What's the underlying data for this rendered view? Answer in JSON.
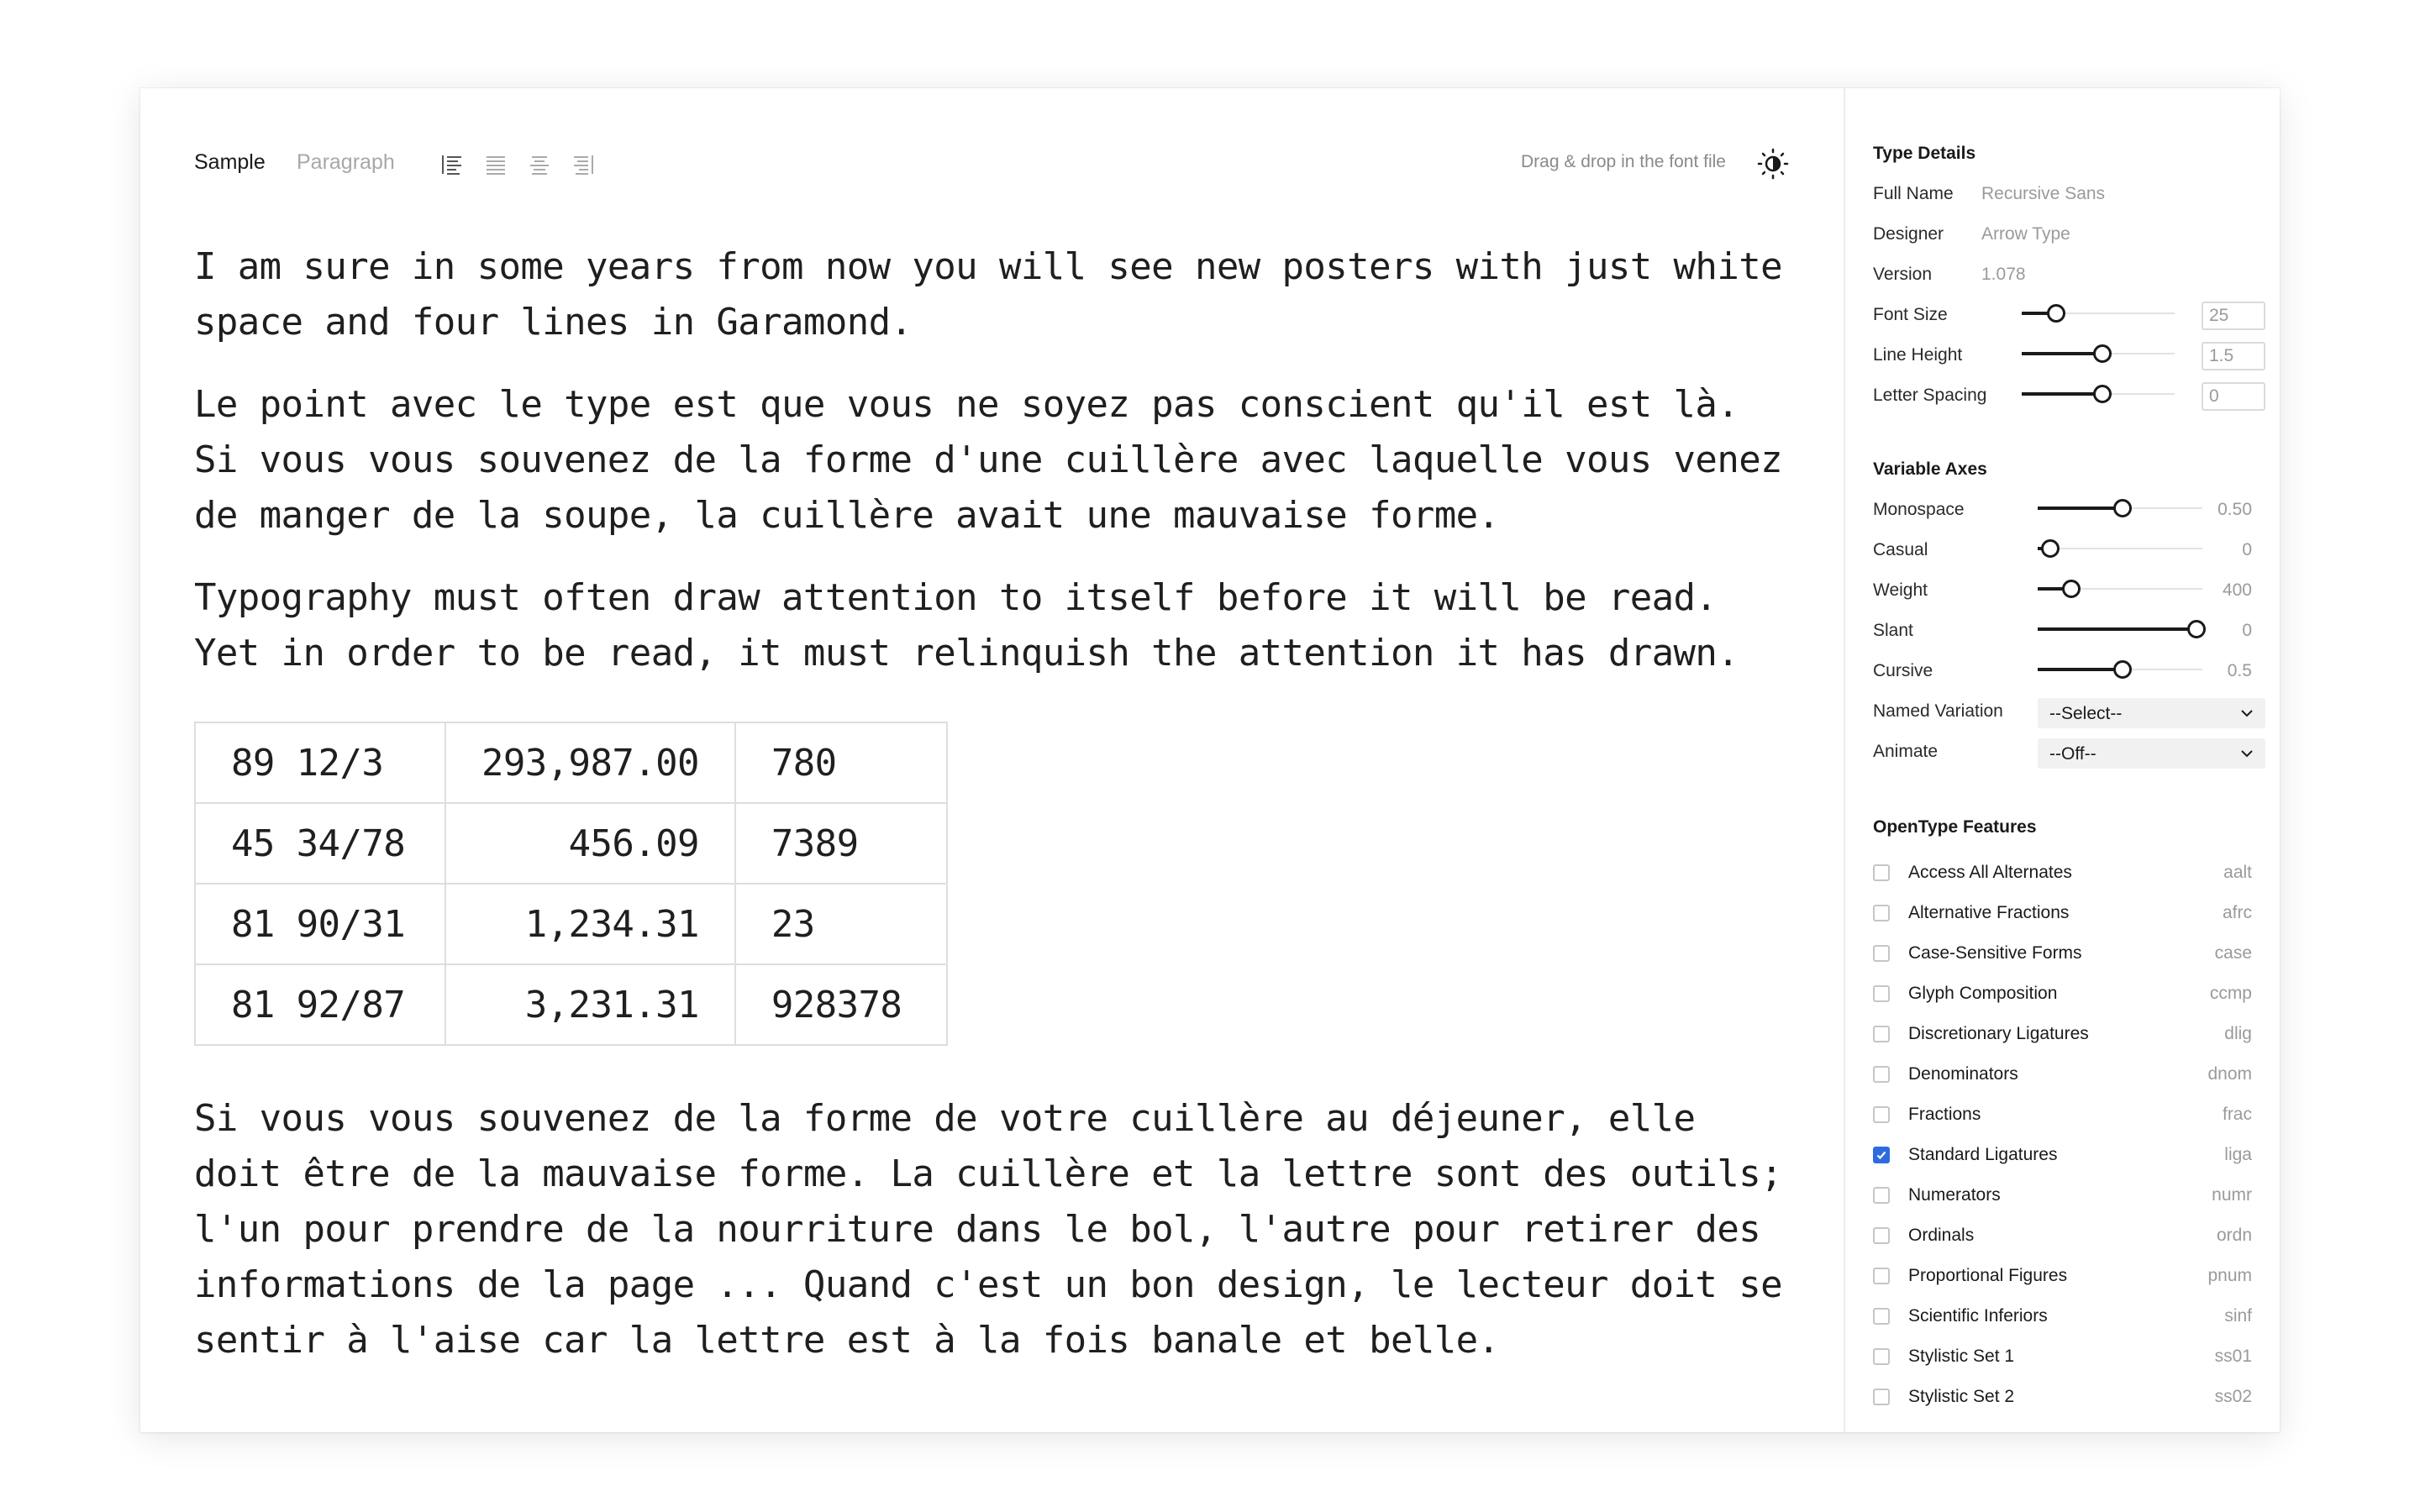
{
  "toolbar": {
    "tabs": [
      {
        "label": "Sample",
        "active": true
      },
      {
        "label": "Paragraph",
        "active": false
      }
    ],
    "align_icons": [
      "align-left-icon",
      "align-justify-icon",
      "align-center-icon",
      "align-right-icon"
    ],
    "drop_hint": "Drag & drop in the font file",
    "theme_icon": "brightness-toggle-icon"
  },
  "sample": {
    "paragraphs": [
      "I am sure in some years from now you will see new posters with just white space and four lines in Garamond.",
      "Le point avec le type est que vous ne soyez pas conscient qu'il est là. Si vous vous souvenez de la forme d'une cuillère avec laquelle vous venez de manger de la soupe, la cuillère avait une mauvaise forme.",
      "Typography must often draw attention to itself before it will be read. Yet in order to be read, it must relinquish the attention it has drawn.",
      "Si vous vous souvenez de la forme de votre cuillère au déjeuner, elle doit être de la mauvaise forme. La cuillère et la lettre sont des outils; l'un pour prendre de la nourriture dans le bol, l'autre pour retirer des informations de la page ... Quand c'est un bon design, le lecteur doit se sentir à l'aise car la lettre est à la fois banale et belle."
    ],
    "table": [
      [
        "89 12/3",
        "293,987.00",
        "780"
      ],
      [
        "45 34/78",
        "456.09",
        "7389"
      ],
      [
        "81 90/31",
        "1,234.31",
        "23"
      ],
      [
        "81 92/87",
        "3,231.31",
        "928378"
      ]
    ]
  },
  "sidebar": {
    "type_details": {
      "title": "Type Details",
      "full_name_label": "Full Name",
      "full_name": "Recursive Sans",
      "designer_label": "Designer",
      "designer": "Arrow Type",
      "version_label": "Version",
      "version": "1.078",
      "font_size_label": "Font Size",
      "font_size": "25",
      "font_size_level": 0.22,
      "line_height_label": "Line Height",
      "line_height": "1.5",
      "line_height_level": 0.52,
      "letter_spacing_label": "Letter Spacing",
      "letter_spacing": "0",
      "letter_spacing_level": 0.52
    },
    "variable_axes": {
      "title": "Variable Axes",
      "axes": [
        {
          "label": "Monospace",
          "value": "0.50",
          "level": 0.51
        },
        {
          "label": "Casual",
          "value": "0",
          "level": 0.07
        },
        {
          "label": "Weight",
          "value": "400",
          "level": 0.2
        },
        {
          "label": "Slant",
          "value": "0",
          "level": 0.96
        },
        {
          "label": "Cursive",
          "value": "0.5",
          "level": 0.51
        }
      ],
      "named_variation_label": "Named Variation",
      "named_variation": "--Select--",
      "animate_label": "Animate",
      "animate": "--Off--"
    },
    "opentype": {
      "title": "OpenType Features",
      "features": [
        {
          "name": "Access All Alternates",
          "tag": "aalt",
          "checked": false
        },
        {
          "name": "Alternative Fractions",
          "tag": "afrc",
          "checked": false
        },
        {
          "name": "Case-Sensitive Forms",
          "tag": "case",
          "checked": false
        },
        {
          "name": "Glyph Composition",
          "tag": "ccmp",
          "checked": false
        },
        {
          "name": "Discretionary Ligatures",
          "tag": "dlig",
          "checked": false
        },
        {
          "name": "Denominators",
          "tag": "dnom",
          "checked": false
        },
        {
          "name": "Fractions",
          "tag": "frac",
          "checked": false
        },
        {
          "name": "Standard Ligatures",
          "tag": "liga",
          "checked": true
        },
        {
          "name": "Numerators",
          "tag": "numr",
          "checked": false
        },
        {
          "name": "Ordinals",
          "tag": "ordn",
          "checked": false
        },
        {
          "name": "Proportional Figures",
          "tag": "pnum",
          "checked": false
        },
        {
          "name": "Scientific Inferiors",
          "tag": "sinf",
          "checked": false
        },
        {
          "name": "Stylistic Set 1",
          "tag": "ss01",
          "checked": false
        },
        {
          "name": "Stylistic Set 2",
          "tag": "ss02",
          "checked": false
        }
      ]
    }
  },
  "colors": {
    "accent": "#2d6cdf",
    "text": "#1a1a1a",
    "muted": "#9a9a9a"
  }
}
